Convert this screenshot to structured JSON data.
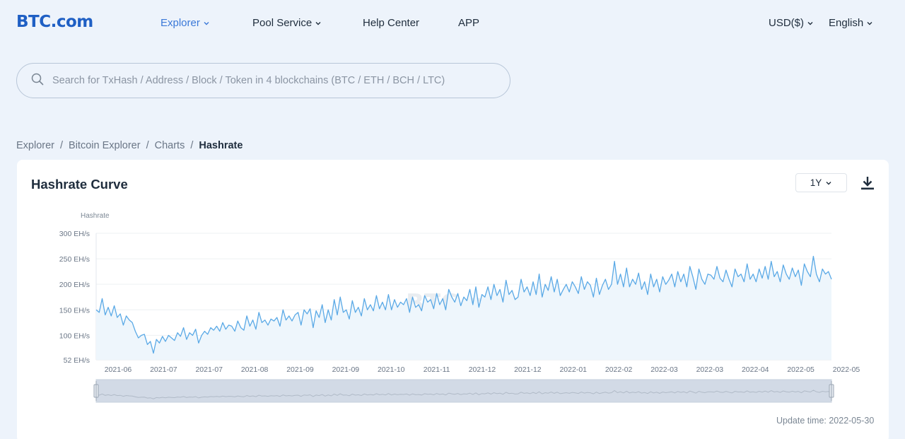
{
  "header": {
    "logo": "BTC.com",
    "nav": [
      {
        "label": "Explorer",
        "active": true,
        "dropdown": true
      },
      {
        "label": "Pool Service",
        "active": false,
        "dropdown": true
      },
      {
        "label": "Help Center",
        "active": false,
        "dropdown": false
      },
      {
        "label": "APP",
        "active": false,
        "dropdown": false
      }
    ],
    "currency": "USD($)",
    "language": "English"
  },
  "search": {
    "placeholder": "Search for TxHash / Address / Block / Token in 4 blockchains (BTC / ETH / BCH / LTC)"
  },
  "breadcrumb": [
    "Explorer",
    "Bitcoin Explorer",
    "Charts",
    "Hashrate"
  ],
  "card": {
    "title": "Hashrate Curve",
    "range": "1Y",
    "update_time": "Update time: 2022-05-30",
    "watermark": "BTC.com"
  },
  "colors": {
    "accent": "#3a78d8",
    "line": "#5aa9e6",
    "area": "#eef6fc"
  },
  "chart_data": {
    "type": "line",
    "ylabel": "Hashrate",
    "y_ticks": [
      "52 EH/s",
      "100 EH/s",
      "150 EH/s",
      "200 EH/s",
      "250 EH/s",
      "300 EH/s"
    ],
    "y_tick_values": [
      52,
      100,
      150,
      200,
      250,
      300
    ],
    "ylim": [
      52,
      300
    ],
    "x_ticks": [
      "2021-06",
      "2021-07",
      "2021-07",
      "2021-08",
      "2021-09",
      "2021-09",
      "2021-10",
      "2021-11",
      "2021-12",
      "2021-12",
      "2022-01",
      "2022-02",
      "2022-03",
      "2022-03",
      "2022-04",
      "2022-05",
      "2022-05"
    ],
    "grid": true,
    "series": [
      {
        "values": [
          150,
          145,
          172,
          140,
          155,
          138,
          158,
          135,
          142,
          120,
          138,
          130,
          125,
          108,
          95,
          100,
          102,
          82,
          88,
          65,
          92,
          85,
          98,
          88,
          100,
          95,
          90,
          105,
          98,
          115,
          92,
          105,
          100,
          112,
          85,
          100,
          108,
          102,
          115,
          110,
          118,
          108,
          125,
          112,
          120,
          118,
          108,
          128,
          115,
          110,
          138,
          118,
          130,
          112,
          145,
          125,
          130,
          120,
          132,
          128,
          135,
          118,
          150,
          130,
          138,
          128,
          140,
          145,
          120,
          150,
          142,
          152,
          115,
          148,
          135,
          160,
          125,
          150,
          130,
          170,
          140,
          175,
          145,
          150,
          132,
          168,
          145,
          155,
          138,
          172,
          150,
          160,
          148,
          178,
          152,
          165,
          150,
          180,
          150,
          170,
          155,
          165,
          160,
          172,
          145,
          175,
          155,
          160,
          148,
          178,
          165,
          170,
          152,
          182,
          160,
          172,
          150,
          190,
          175,
          165,
          182,
          158,
          175,
          168,
          190,
          160,
          195,
          155,
          180,
          175,
          195,
          170,
          200,
          178,
          190,
          165,
          208,
          180,
          188,
          170,
          175,
          210,
          185,
          195,
          178,
          205,
          180,
          220,
          175,
          200,
          188,
          215,
          185,
          210,
          178,
          190,
          200,
          185,
          205,
          195,
          182,
          215,
          190,
          205,
          198,
          175,
          212,
          180,
          198,
          210,
          190,
          200,
          245,
          200,
          220,
          195,
          232,
          195,
          210,
          200,
          222,
          190,
          205,
          180,
          220,
          195,
          210,
          185,
          215,
          200,
          208,
          220,
          195,
          225,
          205,
          220,
          195,
          235,
          215,
          190,
          230,
          210,
          200,
          220,
          218,
          210,
          235,
          212,
          205,
          228,
          210,
          195,
          230,
          215,
          220,
          205,
          240,
          210,
          220,
          205,
          230,
          212,
          235,
          210,
          245,
          215,
          225,
          205,
          238,
          220,
          210,
          232,
          215,
          228,
          198,
          240,
          225,
          215,
          255,
          220,
          205,
          230,
          220,
          225,
          210
        ]
      }
    ]
  }
}
